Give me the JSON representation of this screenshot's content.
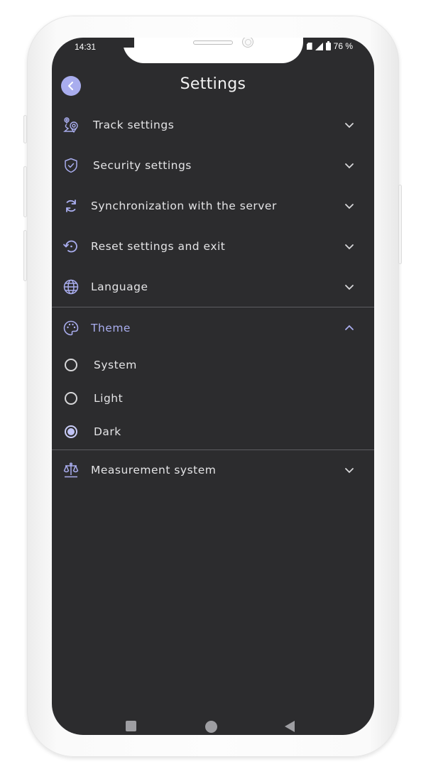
{
  "status_bar": {
    "time": "14:31",
    "battery_percent": "76 %",
    "icons": [
      "sim-card-icon",
      "signal-icon",
      "battery-icon"
    ]
  },
  "header": {
    "back_icon": "chevron-left-icon",
    "title": "Settings"
  },
  "colors": {
    "accent": "#a9adee",
    "background": "#2c2c2e",
    "text": "#e4e4e6",
    "divider": "#5e5e62"
  },
  "settings": {
    "items": [
      {
        "label": "Track settings",
        "icon": "route-pin-icon",
        "expanded": false
      },
      {
        "label": "Security settings",
        "icon": "shield-check-icon",
        "expanded": false
      },
      {
        "label": "Synchronization with the server",
        "icon": "sync-icon",
        "expanded": false
      },
      {
        "label": "Reset settings and exit",
        "icon": "reset-icon",
        "expanded": false
      },
      {
        "label": "Language",
        "icon": "globe-icon",
        "expanded": false
      },
      {
        "label": "Theme",
        "icon": "palette-icon",
        "expanded": true
      },
      {
        "label": "Measurement system",
        "icon": "scales-icon",
        "expanded": false
      }
    ],
    "theme_options": [
      {
        "label": "System",
        "selected": false
      },
      {
        "label": "Light",
        "selected": false
      },
      {
        "label": "Dark",
        "selected": true
      }
    ]
  },
  "navigation_bar": {
    "buttons": [
      "recents-square-icon",
      "home-circle-icon",
      "back-triangle-icon"
    ]
  }
}
